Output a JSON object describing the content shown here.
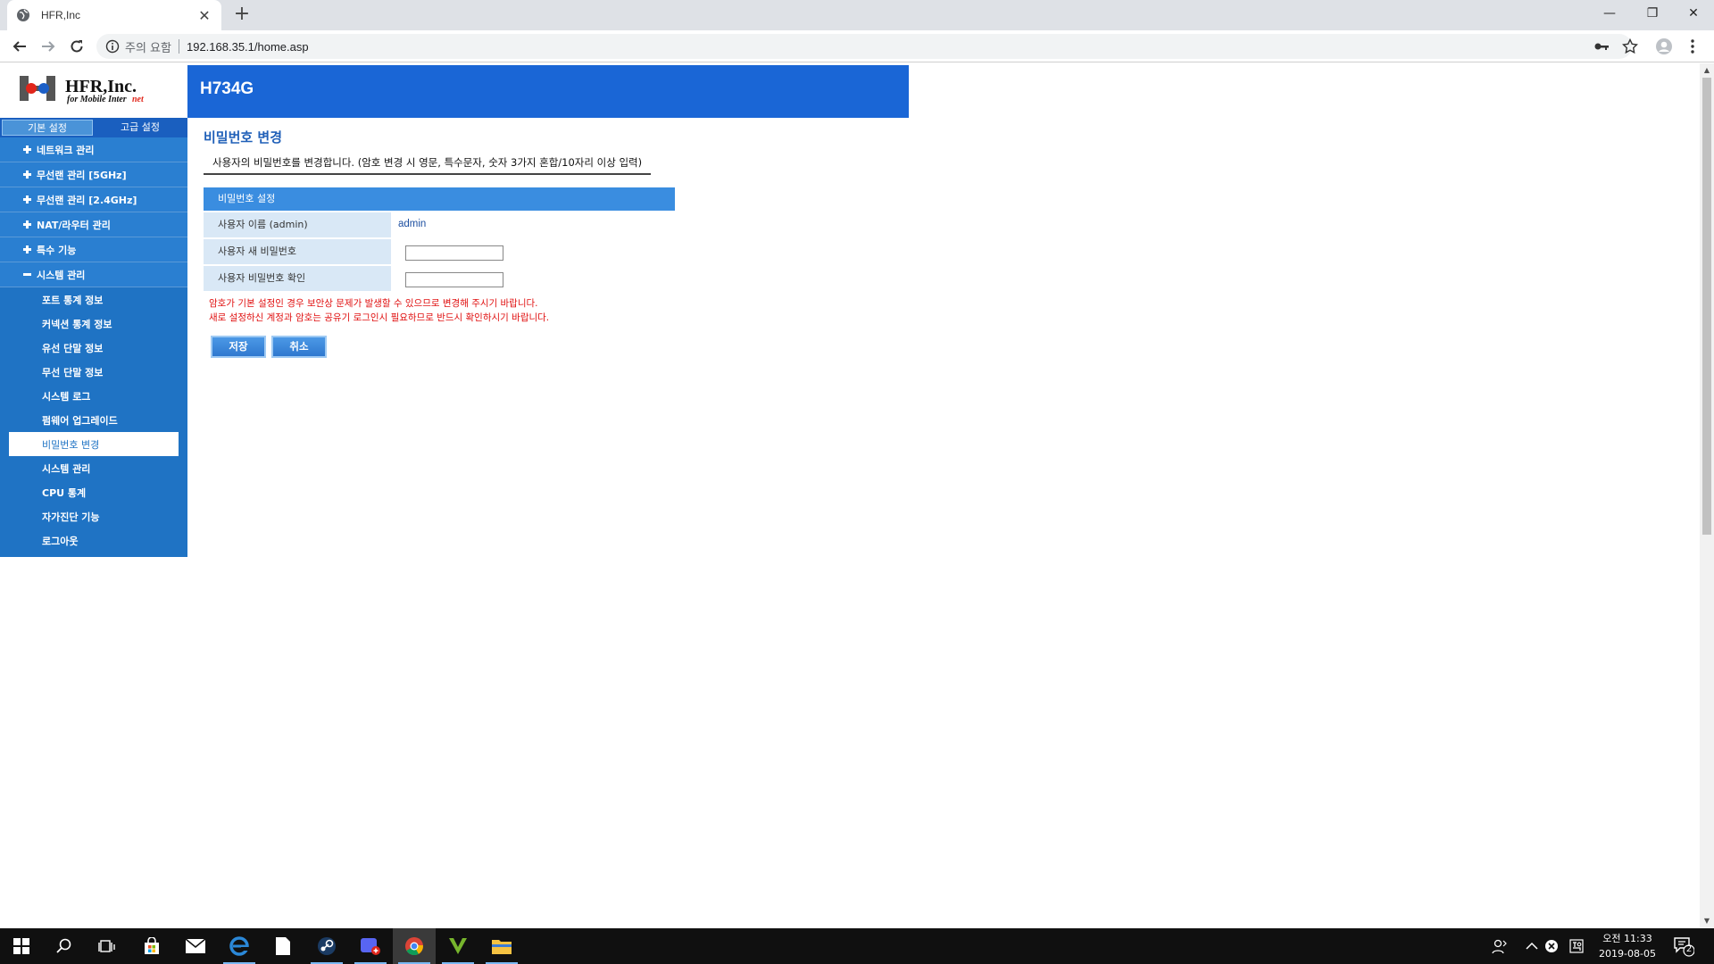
{
  "browser": {
    "tab_title": "HFR,Inc",
    "security_label": "주의 요함",
    "url": "192.168.35.1/home.asp"
  },
  "header": {
    "model": "H734G"
  },
  "menu_tabs": {
    "basic": "기본 설정",
    "advanced": "고급 설정"
  },
  "sidebar": {
    "items": [
      {
        "label": "네트워크 관리"
      },
      {
        "label": "무선랜 관리 [5GHz]"
      },
      {
        "label": "무선랜 관리 [2.4GHz]"
      },
      {
        "label": "NAT/라우터 관리"
      },
      {
        "label": "특수 기능"
      },
      {
        "label": "시스템 관리"
      }
    ],
    "subitems": [
      {
        "label": "포트 통계 정보"
      },
      {
        "label": "커넥션 통계 정보"
      },
      {
        "label": "유선 단말 정보"
      },
      {
        "label": "무선 단말 정보"
      },
      {
        "label": "시스템 로그"
      },
      {
        "label": "펌웨어 업그레이드"
      },
      {
        "label": "비밀번호 변경"
      },
      {
        "label": "시스템 관리"
      },
      {
        "label": "CPU 통계"
      },
      {
        "label": "자가진단 기능"
      },
      {
        "label": "로그아웃"
      }
    ]
  },
  "content": {
    "title": "비밀번호 변경",
    "description": "사용자의 비밀번호를 변경합니다. (암호 변경 시 영문, 특수문자, 숫자 3가지 혼합/10자리 이상 입력)",
    "section_title": "비밀번호 설정",
    "rows": [
      {
        "label": "사용자 이름 (admin)",
        "value": "admin"
      },
      {
        "label": "사용자 새 비밀번호",
        "value": ""
      },
      {
        "label": "사용자 비밀번호 확인",
        "value": ""
      }
    ],
    "warning_line1": "암호가 기본 설정인 경우 보안상 문제가 발생할 수 있으므로 변경해 주시기 바랍니다.",
    "warning_line2": "새로 설정하신 계정과 암호는 공유기 로그인시 필요하므로 반드시 확인하시기 바랍니다.",
    "save_label": "저장",
    "cancel_label": "취소"
  },
  "taskbar": {
    "time": "오전 11:33",
    "date": "2019-08-05",
    "notification_count": "2"
  },
  "colors": {
    "header_blue": "#1a66d6",
    "sidebar_blue": "#1f73c4",
    "warning_red": "#e01010"
  }
}
